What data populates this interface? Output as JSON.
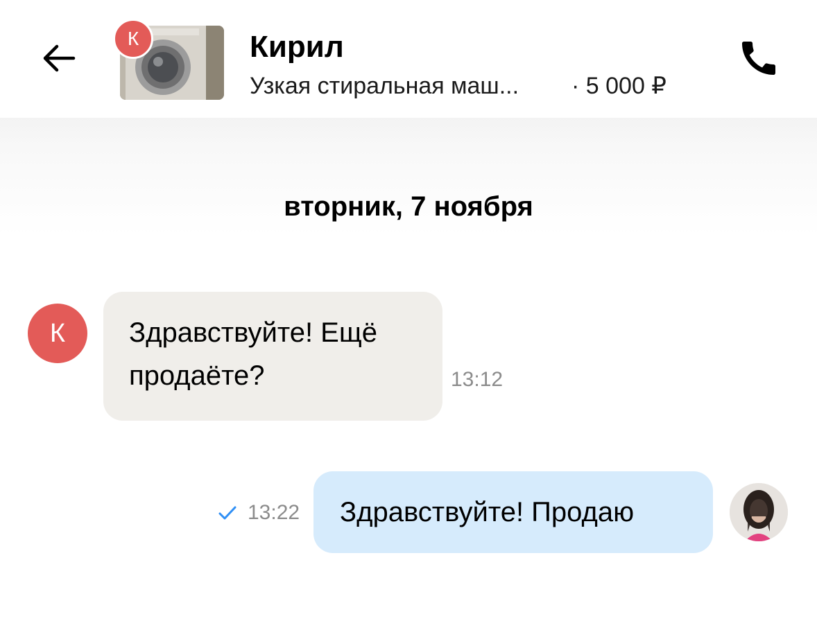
{
  "header": {
    "contact_name": "Кирил",
    "avatar_letter": "К",
    "product_title": "Узкая стиральная маш...",
    "price": "· 5 000 ₽",
    "back_icon": "arrow-left-icon",
    "call_icon": "phone-icon"
  },
  "chat": {
    "date_separator": "вторник, 7 ноября",
    "messages": [
      {
        "direction": "incoming",
        "avatar_letter": "К",
        "lines": [
          "Здравствуйте! Ещё",
          "продаёте?"
        ],
        "time": "13:12"
      },
      {
        "direction": "outgoing",
        "text": "Здравствуйте! Продаю",
        "time": "13:22",
        "status_icon": "check-icon"
      }
    ]
  },
  "colors": {
    "avatar_red": "#e35b58",
    "incoming_bubble": "#f0eeea",
    "outgoing_bubble": "#d6ebfc",
    "check_blue": "#2f8ff5",
    "time_gray": "#8b8b8b"
  }
}
